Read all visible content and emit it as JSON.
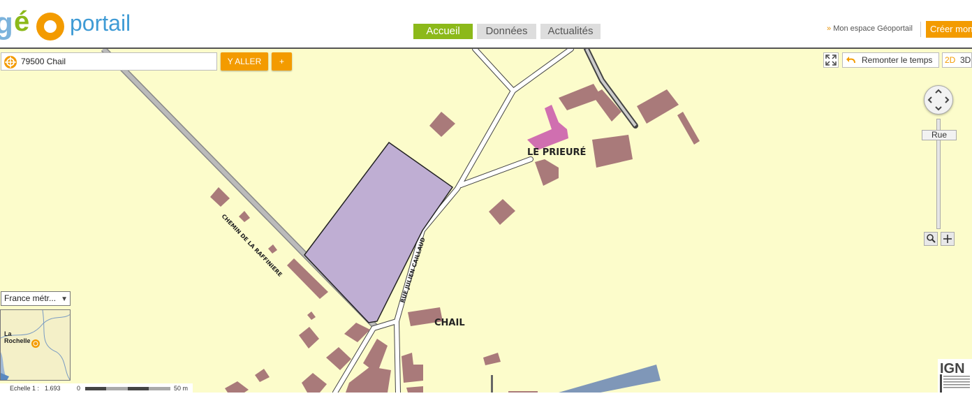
{
  "header": {
    "nav_tabs": [
      {
        "label": "Accueil",
        "active": true
      },
      {
        "label": "Données",
        "active": false
      },
      {
        "label": "Actualités",
        "active": false
      }
    ],
    "mon_espace": "Mon espace Géoportail",
    "creer": "Créer mon"
  },
  "search": {
    "value": "79500 Chail",
    "go_label": "Y ALLER",
    "plus_label": "+"
  },
  "toolbar": {
    "remonter": "Remonter le temps",
    "mode_2d": "2D",
    "mode_3d": "3D"
  },
  "zoom": {
    "level_label": "Rue"
  },
  "projection": {
    "selected": "France métr..."
  },
  "overview": {
    "city_line1": "La",
    "city_line2": "Rochelle"
  },
  "scale": {
    "echelle": "Echelle 1 :",
    "ratio": "1.693",
    "start": "0",
    "end": "50 m"
  },
  "map": {
    "labels": {
      "le_prieure": "LE PRIEURÉ",
      "chail": "CHAIL",
      "chemin": "CHEMIN DE LA RAFFINIERE",
      "rue": "RUE JULIEN CAILLAUD"
    }
  },
  "colors": {
    "accent_green": "#8cb91a",
    "accent_orange": "#f39b00",
    "map_bg": "#fcfccb",
    "building": "#a97a7a",
    "parcel": "#bfaed3"
  }
}
